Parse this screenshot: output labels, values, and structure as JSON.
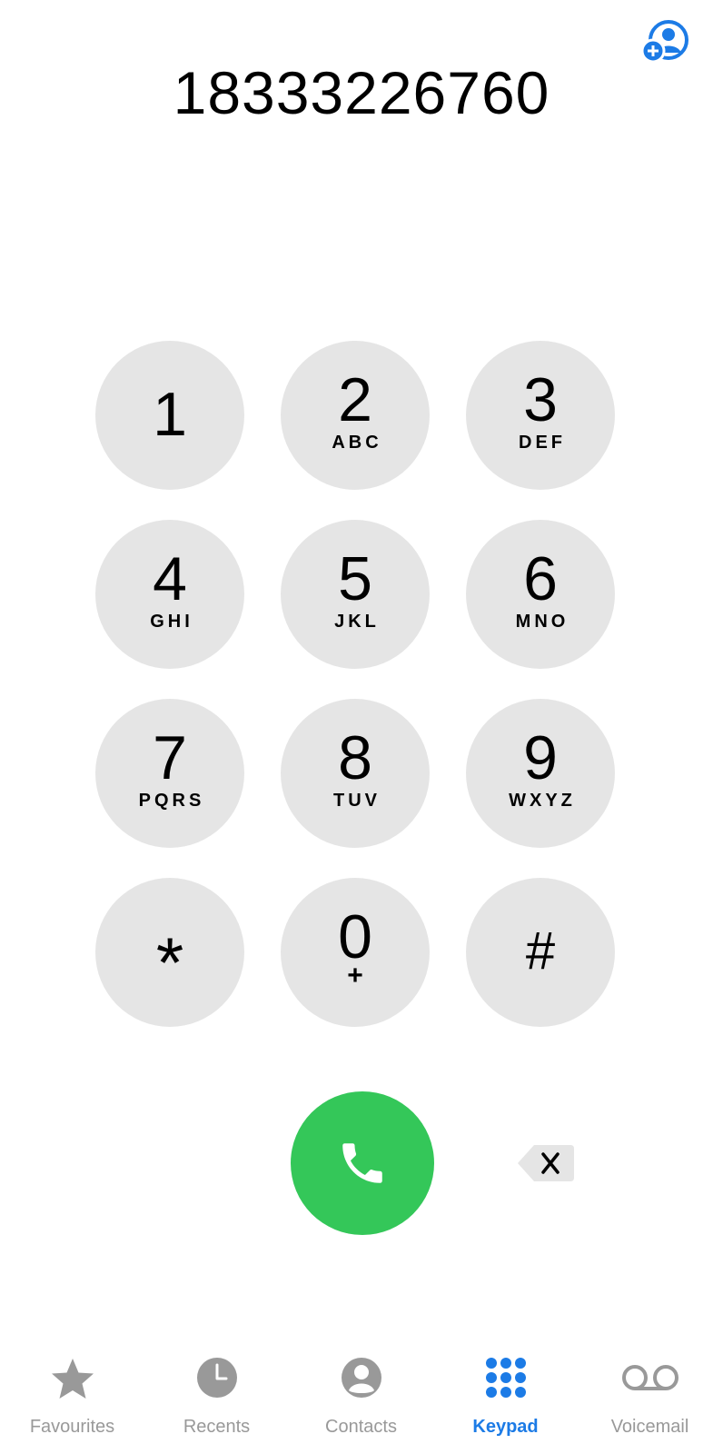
{
  "dialer": {
    "number": "18333226760"
  },
  "colors": {
    "accent": "#1c7be6",
    "call_green": "#34c759",
    "key_background": "#e5e5e5",
    "inactive_tab": "#999999"
  },
  "keys": [
    {
      "digit": "1",
      "letters": ""
    },
    {
      "digit": "2",
      "letters": "ABC"
    },
    {
      "digit": "3",
      "letters": "DEF"
    },
    {
      "digit": "4",
      "letters": "GHI"
    },
    {
      "digit": "5",
      "letters": "JKL"
    },
    {
      "digit": "6",
      "letters": "MNO"
    },
    {
      "digit": "7",
      "letters": "PQRS"
    },
    {
      "digit": "8",
      "letters": "TUV"
    },
    {
      "digit": "9",
      "letters": "WXYZ"
    },
    {
      "digit": "*",
      "letters": ""
    },
    {
      "digit": "0",
      "letters": "+"
    },
    {
      "digit": "#",
      "letters": ""
    }
  ],
  "icons": {
    "add_contact": "add-contact-icon",
    "call": "phone-icon",
    "backspace": "backspace-icon"
  },
  "tabs": [
    {
      "label": "Favourites",
      "icon": "star-icon",
      "active": false
    },
    {
      "label": "Recents",
      "icon": "clock-icon",
      "active": false
    },
    {
      "label": "Contacts",
      "icon": "person-circle-icon",
      "active": false
    },
    {
      "label": "Keypad",
      "icon": "keypad-grid-icon",
      "active": true
    },
    {
      "label": "Voicemail",
      "icon": "voicemail-icon",
      "active": false
    }
  ]
}
